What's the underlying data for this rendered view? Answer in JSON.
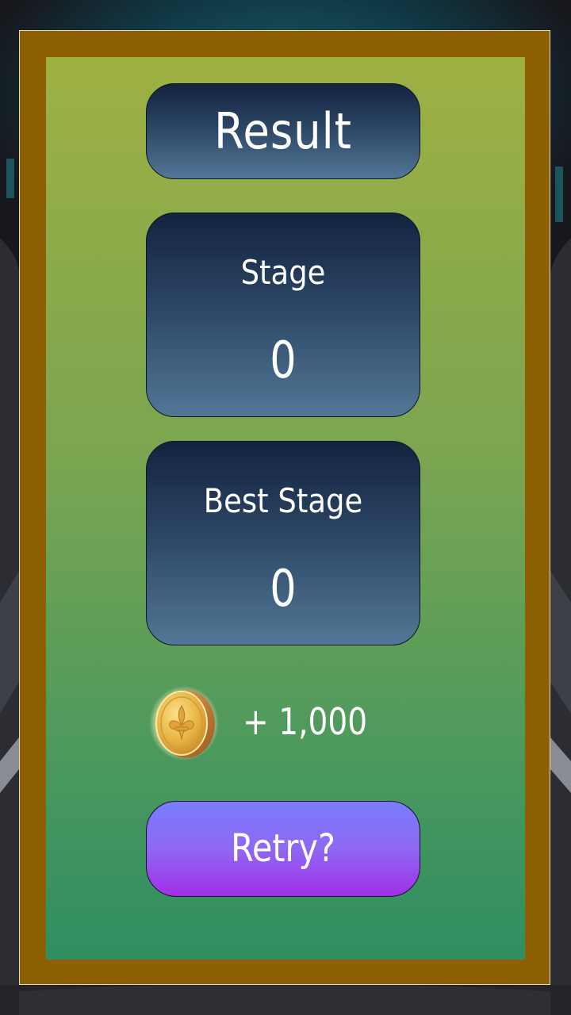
{
  "result_panel": {
    "title": "Result",
    "stage": {
      "label": "Stage",
      "value": "0"
    },
    "best_stage": {
      "label": "Best Stage",
      "value": "0"
    },
    "reward": {
      "icon": "gold-fleur-de-lis-coin-icon",
      "amount": "+ 1,000"
    },
    "retry_label": "Retry?"
  },
  "colors": {
    "frame": "#8c6003",
    "panel_top": "#9eb042",
    "panel_bottom": "#2f8e62",
    "box_top": "#13233f",
    "box_bottom": "#527796",
    "retry_top": "#7a7cff",
    "retry_bottom": "#a22fe8",
    "text": "#ffffff"
  }
}
